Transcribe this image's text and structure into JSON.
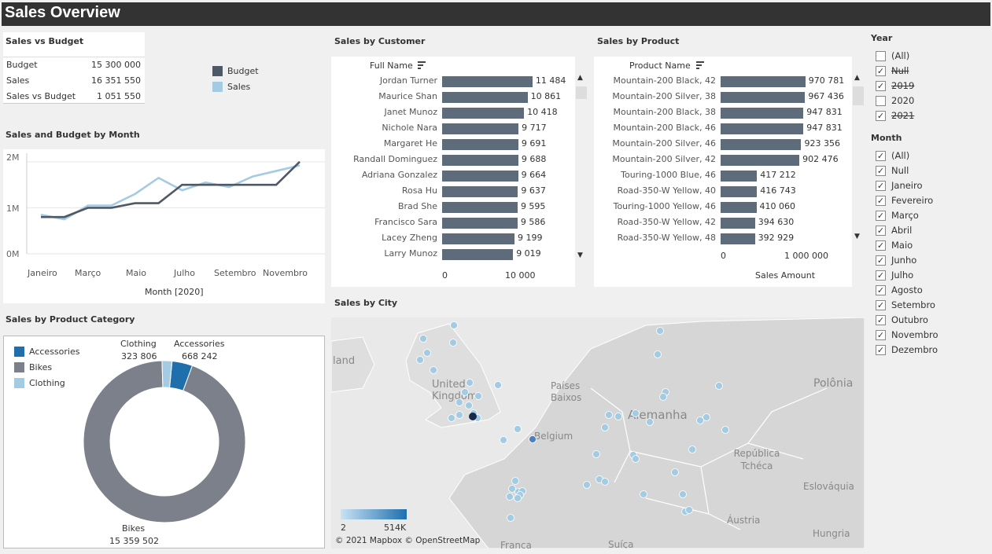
{
  "dashboard": {
    "title": "Sales Overview"
  },
  "sales_vs_budget": {
    "title": "Sales vs Budget",
    "rows": [
      {
        "label": "Budget",
        "value": "15 300 000"
      },
      {
        "label": "Sales",
        "value": "16 351 550"
      },
      {
        "label": "Sales vs Budget",
        "value": "1 051 550"
      }
    ],
    "legend": [
      {
        "label": "Budget",
        "color": "#4f5866"
      },
      {
        "label": "Sales",
        "color": "#a3cbe3"
      }
    ]
  },
  "month_chart": {
    "title": "Sales and Budget by Month",
    "y_ticks": [
      "2M",
      "1M",
      "0M"
    ],
    "x_ticks": [
      "Janeiro",
      "Março",
      "Maio",
      "Julho",
      "Setembro",
      "Novembro"
    ],
    "xlabel": "Month [2020]"
  },
  "chart_data": [
    {
      "type": "line",
      "title": "Sales and Budget by Month",
      "xlabel": "Month [2020]",
      "ylabel": "",
      "ylim": [
        0,
        2100000
      ],
      "x": [
        "Janeiro",
        "Fevereiro",
        "Março",
        "Abril",
        "Maio",
        "Junho",
        "Julho",
        "Agosto",
        "Setembro",
        "Outubro",
        "Novembro",
        "Dezembro"
      ],
      "series": [
        {
          "name": "Budget",
          "color": "#4f5866",
          "values": [
            800000,
            800000,
            1000000,
            1000000,
            1100000,
            1100000,
            1500000,
            1500000,
            1500000,
            1500000,
            1500000,
            2000000
          ]
        },
        {
          "name": "Sales",
          "color": "#a3cbe3",
          "values": [
            850000,
            750000,
            1050000,
            1050000,
            1300000,
            1650000,
            1380000,
            1550000,
            1450000,
            1680000,
            1800000,
            1920000
          ]
        }
      ]
    },
    {
      "type": "bar",
      "title": "Sales by Customer",
      "xlabel": "",
      "categories": [
        "Jordan Turner",
        "Maurice Shan",
        "Janet Munoz",
        "Nichole Nara",
        "Margaret He",
        "Randall Dominguez",
        "Adriana Gonzalez",
        "Rosa Hu",
        "Brad She",
        "Francisco Sara",
        "Lacey Zheng",
        "Larry Munoz"
      ],
      "values": [
        11484,
        10861,
        10418,
        9717,
        9691,
        9688,
        9664,
        9637,
        9595,
        9586,
        9199,
        9019
      ],
      "labels": [
        "11 484",
        "10 861",
        "10 418",
        "9 717",
        "9 691",
        "9 688",
        "9 664",
        "9 637",
        "9 595",
        "9 586",
        "9 199",
        "9 019"
      ],
      "x_ticks": [
        "0",
        "10 000"
      ],
      "xlim": [
        0,
        14000
      ]
    },
    {
      "type": "bar",
      "title": "Sales by Product",
      "xlabel": "Sales Amount",
      "categories": [
        "Mountain-200 Black, 42",
        "Mountain-200 Silver, 38",
        "Mountain-200 Black, 38",
        "Mountain-200 Black, 46",
        "Mountain-200 Silver, 46",
        "Mountain-200 Silver, 42",
        "Touring-1000 Blue, 46",
        "Road-350-W Yellow, 40",
        "Touring-1000 Yellow, 46",
        "Road-350-W Yellow, 42",
        "Road-350-W Yellow, 48"
      ],
      "values": [
        970781,
        967436,
        947831,
        947831,
        923356,
        902476,
        417212,
        416743,
        410060,
        394630,
        392929
      ],
      "labels": [
        "970 781",
        "967 436",
        "947 831",
        "947 831",
        "923 356",
        "902 476",
        "417 212",
        "416 743",
        "410 060",
        "394 630",
        "392 929"
      ],
      "x_ticks": [
        "0",
        "1 000 000"
      ],
      "xlim": [
        0,
        1500000
      ]
    },
    {
      "type": "pie",
      "title": "Sales by Product Category",
      "categories": [
        "Accessories",
        "Bikes",
        "Clothing"
      ],
      "values": [
        668242,
        15359502,
        323806
      ],
      "labels": [
        "668 242",
        "15 359 502",
        "323 806"
      ],
      "colors": [
        "#1f6fad",
        "#7b808a",
        "#a3cbe3"
      ]
    }
  ],
  "customer_chart": {
    "title": "Sales by Customer",
    "header": "Full Name"
  },
  "product_chart": {
    "title": "Sales by Product",
    "header": "Product Name"
  },
  "category_chart": {
    "title": "Sales by Product Category"
  },
  "city_map": {
    "title": "Sales by City",
    "legend_min": "2",
    "legend_max": "514K",
    "attribution": "© 2021 Mapbox © OpenStreetMap",
    "labels": [
      "land",
      "United Kingdom",
      "Países Baixos",
      "Belgium",
      "Alemanha",
      "Polônia",
      "República Tchéca",
      "Eslováquia",
      "Áustria",
      "Hungria",
      "França",
      "Suíça"
    ]
  },
  "year_filter": {
    "title": "Year",
    "items": [
      {
        "label": "(All)",
        "checked": false,
        "strike": false
      },
      {
        "label": "Null",
        "checked": true,
        "strike": true
      },
      {
        "label": "2019",
        "checked": true,
        "strike": true
      },
      {
        "label": "2020",
        "checked": false,
        "strike": false
      },
      {
        "label": "2021",
        "checked": true,
        "strike": true
      }
    ]
  },
  "month_filter": {
    "title": "Month",
    "items": [
      {
        "label": "(All)",
        "checked": true
      },
      {
        "label": "Null",
        "checked": true
      },
      {
        "label": "Janeiro",
        "checked": true
      },
      {
        "label": "Fevereiro",
        "checked": true
      },
      {
        "label": "Março",
        "checked": true
      },
      {
        "label": "Abril",
        "checked": true
      },
      {
        "label": "Maio",
        "checked": true
      },
      {
        "label": "Junho",
        "checked": true
      },
      {
        "label": "Julho",
        "checked": true
      },
      {
        "label": "Agosto",
        "checked": true
      },
      {
        "label": "Setembro",
        "checked": true
      },
      {
        "label": "Outubro",
        "checked": true
      },
      {
        "label": "Novembro",
        "checked": true
      },
      {
        "label": "Dezembro",
        "checked": true
      }
    ]
  }
}
